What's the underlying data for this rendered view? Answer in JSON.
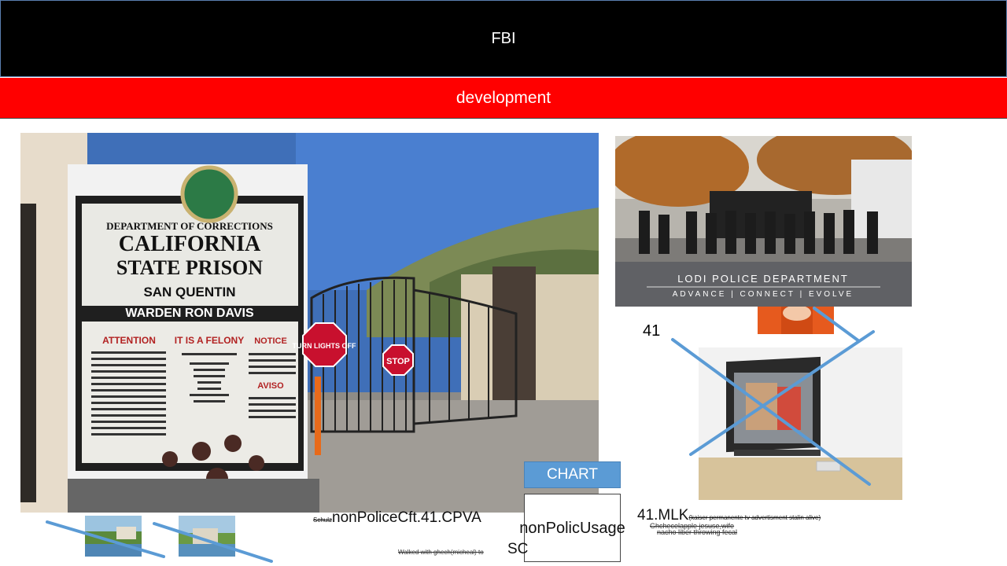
{
  "header": {
    "title": "FBI"
  },
  "banner": {
    "subtitle": "development"
  },
  "prison_sign": {
    "department": "DEPARTMENT OF CORRECTIONS",
    "line1": "CALIFORNIA",
    "line2": "STATE PRISON",
    "name": "SAN QUENTIN",
    "warden": "WARDEN RON DAVIS",
    "col1_title": "ATTENTION",
    "col2_title": "IT IS A FELONY",
    "col3_title": "NOTICE",
    "col3_sub": "AVISO",
    "turn_sign": "TURN LIGHTS OFF",
    "stop_sign": "STOP"
  },
  "police_photo": {
    "title": "LODI POLICE DEPARTMENT",
    "tagline": "ADVANCE  |  CONNECT  |  EVOLVE"
  },
  "labels": {
    "number_41": "41",
    "chart_button": "CHART",
    "chart_box": "nonPolicUsage",
    "sc": "SC"
  },
  "bottom_caption": {
    "prefix_small": "Schulz",
    "main": "nonPoliceCft.41.CPVA",
    "note": "Walked with ghech(micheal) to"
  },
  "mlk_caption": {
    "main": "41.MLK",
    "small": "(kaiser permanente tv advertisment stalin alive)",
    "note1": "Ghchecelapple jesuse,wife",
    "note2": "nacho liber throwing fecal"
  },
  "colors": {
    "header_bg": "#000000",
    "banner_bg": "#ff0000",
    "chart_blue": "#5b9bd5",
    "strike_blue": "#5b9bd5"
  }
}
